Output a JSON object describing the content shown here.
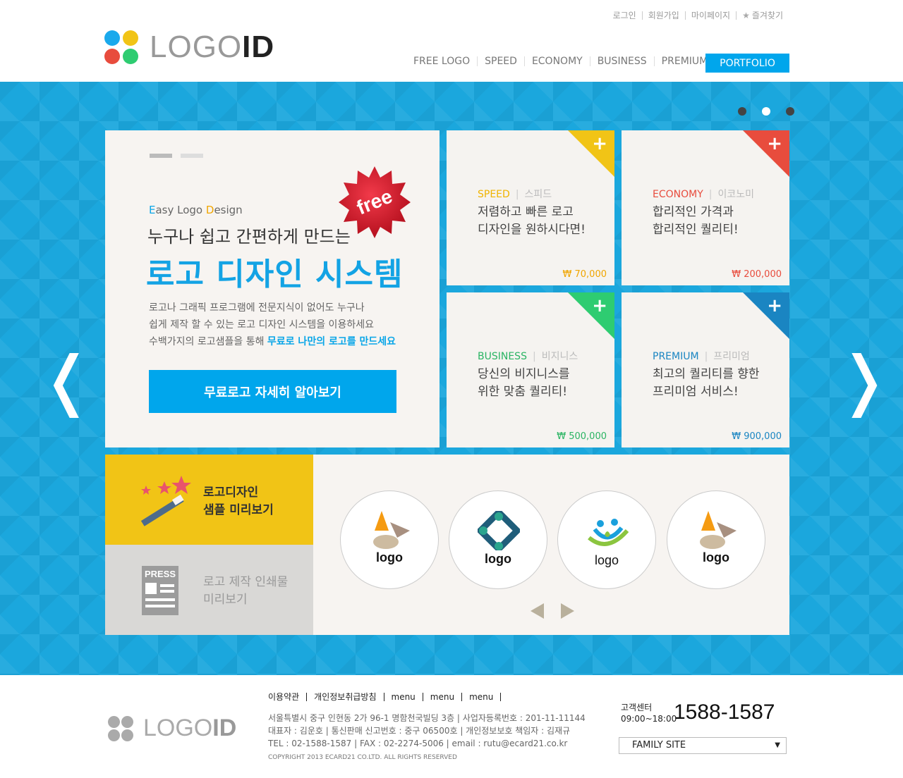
{
  "colors": {
    "brand_blue": "#00a6ec",
    "band_blue": "#1ba7dd",
    "yellow": "#f1c416",
    "red": "#e84c3d",
    "green": "#2ecc71",
    "teal_blue": "#1a85c2"
  },
  "header": {
    "util_links": [
      "로그인",
      "회원가입",
      "마이페이지",
      "즐겨찾기"
    ],
    "logo": {
      "light": "LOGO",
      "bold": "ID"
    },
    "nav": [
      "FREE LOGO",
      "SPEED",
      "ECONOMY",
      "BUSINESS",
      "PREMIUM"
    ],
    "portfolio": "PORTFOLIO"
  },
  "hero": {
    "eyebrow": {
      "e": "E",
      "asy": "asy Logo ",
      "d": "D",
      "esign": "esign"
    },
    "subtitle": "누구나 쉽고 간편하게 만드는",
    "title": "로고 디자인 시스템",
    "desc_line1": "로고나 그래픽 프로그램에 전문지식이 없어도 누구나",
    "desc_line2": "쉽게 제작 할 수 있는 로고 디자인 시스템을 이용하세요",
    "desc_line3_a": "수백가지의 로고샘플을 통해 ",
    "desc_line3_b": "무료로 나만의 로고를 만드세요",
    "button": "무료로고 자세히 알아보기",
    "badge": "free"
  },
  "cards": [
    {
      "cat": "SPEED",
      "ko": "스피드",
      "line1": "저렴하고 빠른 로고",
      "line2": "디자인을 원하시다면!",
      "price": "₩ 70,000",
      "color": "#f1c416"
    },
    {
      "cat": "ECONOMY",
      "ko": "이코노미",
      "line1": "합리적인 가격과",
      "line2": "합리적인 퀄리티!",
      "price": "₩ 200,000",
      "color": "#e84c3d"
    },
    {
      "cat": "BUSINESS",
      "ko": "비지니스",
      "line1": "당신의 비지니스를",
      "line2": "위한 맞춤 퀄리티!",
      "price": "₩ 500,000",
      "color": "#2ecc71"
    },
    {
      "cat": "PREMIUM",
      "ko": "프리미엄",
      "line1": "최고의 퀄리티를 향한",
      "line2": "프리미엄 서비스!",
      "price": "₩ 900,000",
      "color": "#1a85c2"
    }
  ],
  "panel": {
    "sample_line1": "로고디자인",
    "sample_line2": "샘플 미리보기",
    "press_icon": "PRESS",
    "print_line1": "로고 제작 인쇄물",
    "print_line2": "미리보기",
    "logos": [
      "logo",
      "logo",
      "logo",
      "logo"
    ]
  },
  "footer": {
    "links": [
      "이용약관",
      "개인정보취급방침",
      "menu",
      "menu",
      "menu"
    ],
    "info_line1": "서울특별시 중구 인현동 2가 96-1 명함천국빌딩 3층 | 사업자등록번호 : 201-11-11144",
    "info_line2": "대표자 : 김운호 | 통신판매 신고번호 : 중구 06500호 | 개인정보보호 책임자 : 김재규",
    "info_line3": "TEL : 02-1588-1587 | FAX : 02-2274-5006 | email : rutu@ecard21.co.kr",
    "copyright": "COPYRIGHT 2013 ECARD21 CO.LTD. ALL RIGHTS RESERVED",
    "cs_label": "고객센터",
    "cs_hours": "09:00~18:00",
    "cs_phone": "1588-1587",
    "family_site": "FAMILY SITE"
  }
}
